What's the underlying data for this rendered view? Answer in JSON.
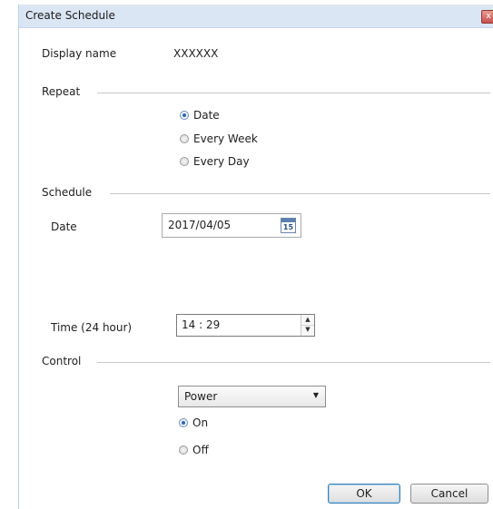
{
  "window": {
    "title": "Create Schedule",
    "close_glyph": "x"
  },
  "display_name": {
    "label": "Display name",
    "value": "XXXXXX"
  },
  "repeat": {
    "heading": "Repeat",
    "options": [
      {
        "label": "Date",
        "checked": true
      },
      {
        "label": "Every Week",
        "checked": false
      },
      {
        "label": "Every Day",
        "checked": false
      }
    ]
  },
  "schedule": {
    "heading": "Schedule",
    "date_label": "Date",
    "date_value": "2017/04/05",
    "calendar_day": "15",
    "time_label": "Time (24 hour)",
    "time_value": "14 : 29"
  },
  "control": {
    "heading": "Control",
    "selected": "Power",
    "options": [
      {
        "label": "On",
        "checked": true
      },
      {
        "label": "Off",
        "checked": false
      }
    ]
  },
  "buttons": {
    "ok": "OK",
    "cancel": "Cancel"
  },
  "icons": {
    "calendar": "calendar-icon",
    "spinner_up": "▲",
    "spinner_down": "▼",
    "dropdown": "▼"
  }
}
